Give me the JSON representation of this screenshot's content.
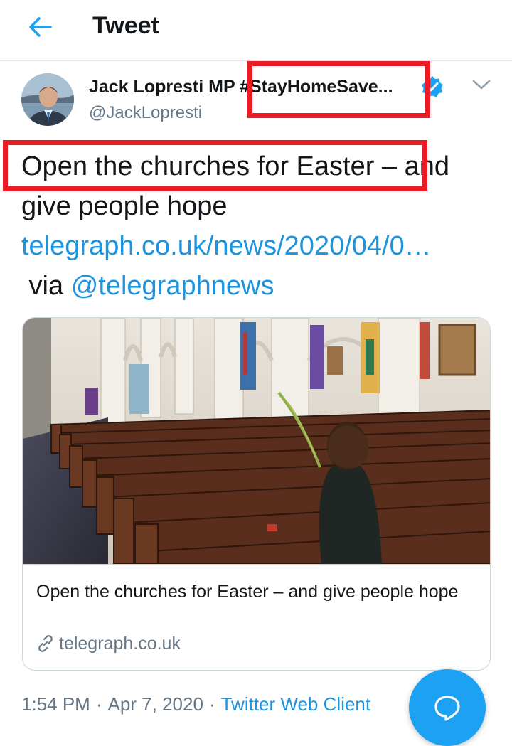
{
  "header": {
    "back_icon": "arrow-left-icon",
    "title": "Tweet"
  },
  "tweet": {
    "author_name": "Jack Lopresti MP #StayHomeSave...",
    "handle": "@JackLopresti",
    "verified": true,
    "text_line1": "Open the churches for Easter – and",
    "text_line2": "give people hope",
    "link_text": "telegraph.co.uk/news/2020/04/0…",
    "via_text": " via ",
    "mention": "@telegraphnews",
    "time": "1:54 PM",
    "date": "Apr 7, 2020",
    "separator": "·",
    "client": "Twitter Web Client"
  },
  "card": {
    "title": "Open the churches for Easter – and give people hope",
    "domain": "telegraph.co.uk",
    "image_alt": "Woman holding a palm frond sitting alone in the pews of an empty church"
  },
  "colors": {
    "accent": "#1da1f2",
    "link": "#1b95e0",
    "secondary_text": "#657786",
    "annotation_red": "#ec1c24"
  }
}
